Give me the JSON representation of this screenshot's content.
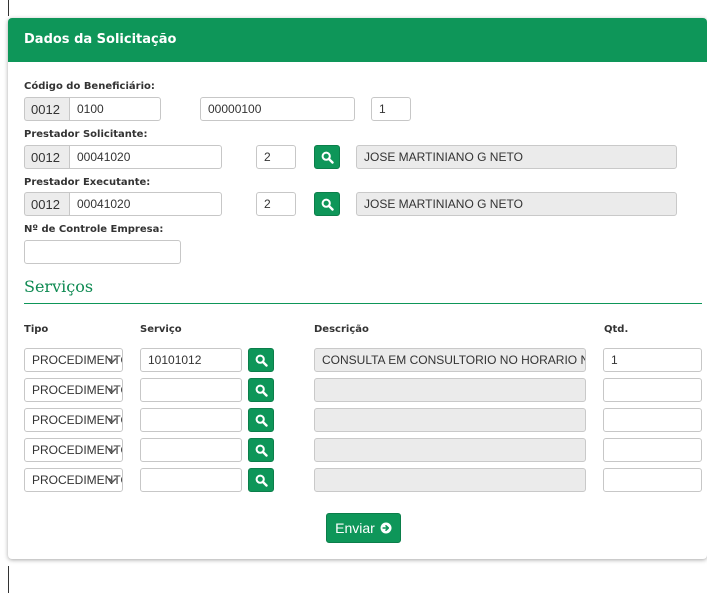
{
  "panel": {
    "title": "Dados da Solicitação"
  },
  "beneficiario": {
    "label": "Código do Beneficiário:",
    "prefix": "0012",
    "code": "0100",
    "number": "00000100",
    "digit": "1"
  },
  "solicitante": {
    "label": "Prestador Solicitante:",
    "prefix": "0012",
    "code": "00041020",
    "digit": "2",
    "name": "JOSE MARTINIANO G NETO"
  },
  "executante": {
    "label": "Prestador Executante:",
    "prefix": "0012",
    "code": "00041020",
    "digit": "2",
    "name": "JOSE MARTINIANO G NETO"
  },
  "controle": {
    "label": "Nº de Controle Empresa:",
    "value": ""
  },
  "servicos": {
    "title": "Serviços",
    "columns": {
      "tipo": "Tipo",
      "servico": "Serviço",
      "descricao": "Descrição",
      "qtd": "Qtd."
    },
    "rows": [
      {
        "tipo": "PROCEDIMENTO",
        "servico": "10101012",
        "descricao": "CONSULTA EM CONSULTORIO NO HORARIO NORMAL",
        "qtd": "1"
      },
      {
        "tipo": "PROCEDIMENTO",
        "servico": "",
        "descricao": "",
        "qtd": ""
      },
      {
        "tipo": "PROCEDIMENTO",
        "servico": "",
        "descricao": "",
        "qtd": ""
      },
      {
        "tipo": "PROCEDIMENTO",
        "servico": "",
        "descricao": "",
        "qtd": ""
      },
      {
        "tipo": "PROCEDIMENTO",
        "servico": "",
        "descricao": "",
        "qtd": ""
      }
    ]
  },
  "actions": {
    "submit_label": "Enviar"
  },
  "colors": {
    "primary": "#0e9659",
    "readonly_bg": "#ebebeb"
  },
  "icons": {
    "search": "search-icon",
    "submit": "arrow-right-circle-icon",
    "select": "chevron-down-icon"
  }
}
